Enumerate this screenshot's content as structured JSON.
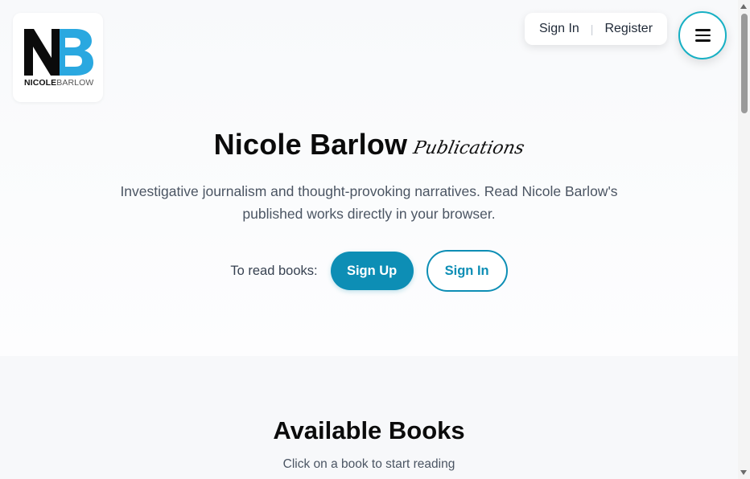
{
  "logo": {
    "monogram": "NB",
    "word_bold": "NICOLE",
    "word_light": "BARLOW"
  },
  "header": {
    "sign_in_label": "Sign In",
    "separator": "|",
    "register_label": "Register",
    "menu_icon": "hamburger-icon"
  },
  "hero": {
    "title": "Nicole Barlow",
    "script_word": "Publications",
    "tagline": "Investigative journalism and thought-provoking narratives. Read Nicole Barlow's published works directly in your browser.",
    "cta_label": "To read books:",
    "signup_label": "Sign Up",
    "signin_label": "Sign In"
  },
  "books": {
    "title": "Available Books",
    "subtitle": "Click on a book to start reading"
  },
  "colors": {
    "accent": "#0d8eb5",
    "menu_ring": "#17b0c4",
    "logo_blue": "#2aa8e0",
    "logo_black": "#0b0b0b"
  }
}
